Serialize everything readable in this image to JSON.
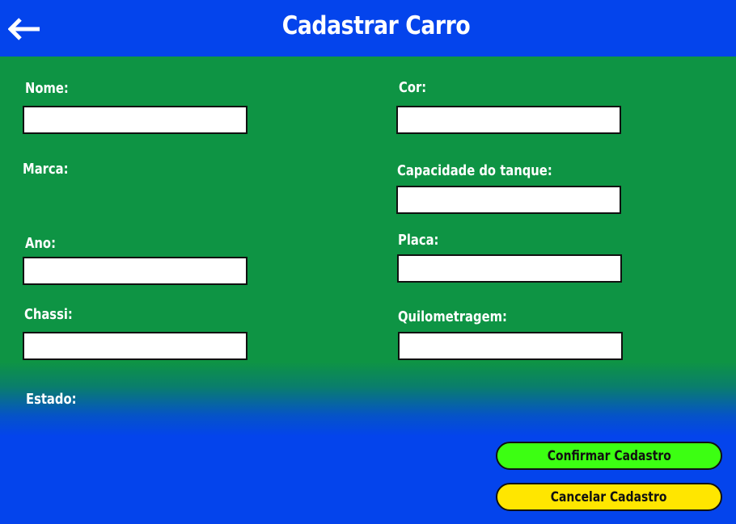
{
  "header": {
    "title": "Cadastrar Carro",
    "back_icon": "arrow-left-icon"
  },
  "form": {
    "nome": {
      "label": "Nome:",
      "value": ""
    },
    "marca": {
      "label": "Marca:"
    },
    "ano": {
      "label": "Ano:",
      "value": ""
    },
    "chassi": {
      "label": "Chassi:",
      "value": ""
    },
    "estado": {
      "label": "Estado:"
    },
    "cor": {
      "label": "Cor:",
      "value": ""
    },
    "capacidade": {
      "label": "Capacidade do tanque:",
      "value": ""
    },
    "placa": {
      "label": "Placa:",
      "value": ""
    },
    "quilometragem": {
      "label": "Quilometragem:",
      "value": ""
    }
  },
  "actions": {
    "confirm_label": "Confirmar Cadastro",
    "cancel_label": "Cancelar Cadastro"
  },
  "colors": {
    "header_bg": "#0444ec",
    "form_bg": "#0e9444",
    "confirm_bg": "#3cff12",
    "cancel_bg": "#ffe600",
    "text": "#ffffff"
  }
}
